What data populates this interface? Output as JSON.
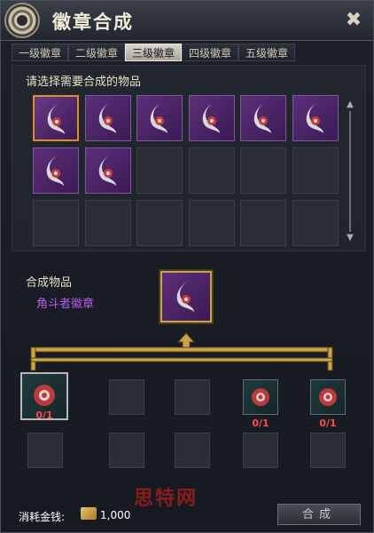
{
  "window": {
    "title": "徽章合成"
  },
  "tabs": [
    {
      "label": "一级徽章",
      "active": false
    },
    {
      "label": "二级徽章",
      "active": false
    },
    {
      "label": "三级徽章",
      "active": true
    },
    {
      "label": "四级徽章",
      "active": false
    },
    {
      "label": "五级徽章",
      "active": false
    }
  ],
  "inventory": {
    "prompt": "请选择需要合成的物品",
    "rows": 3,
    "cols": 6,
    "filled_count": 8,
    "selected_index": 0
  },
  "result": {
    "label": "合成物品",
    "item_name": "角斗者徽章",
    "item_name_color": "#b45df0"
  },
  "materials": {
    "top": [
      {
        "count": "0/1",
        "has_item": true,
        "highlighted": true
      },
      {
        "count": "",
        "has_item": false
      },
      {
        "count": "",
        "has_item": false
      },
      {
        "count": "0/1",
        "has_item": true
      },
      {
        "count": "0/1",
        "has_item": true
      }
    ],
    "bottom_empty_count": 5
  },
  "footer": {
    "cost_label": "消耗金钱:",
    "cost_value": "1,000",
    "merge_button": "合成"
  },
  "watermark": "思特网",
  "colors": {
    "accent": "#e08a2a",
    "gold": "#c9a24a",
    "count_red": "#ff4a4a"
  }
}
